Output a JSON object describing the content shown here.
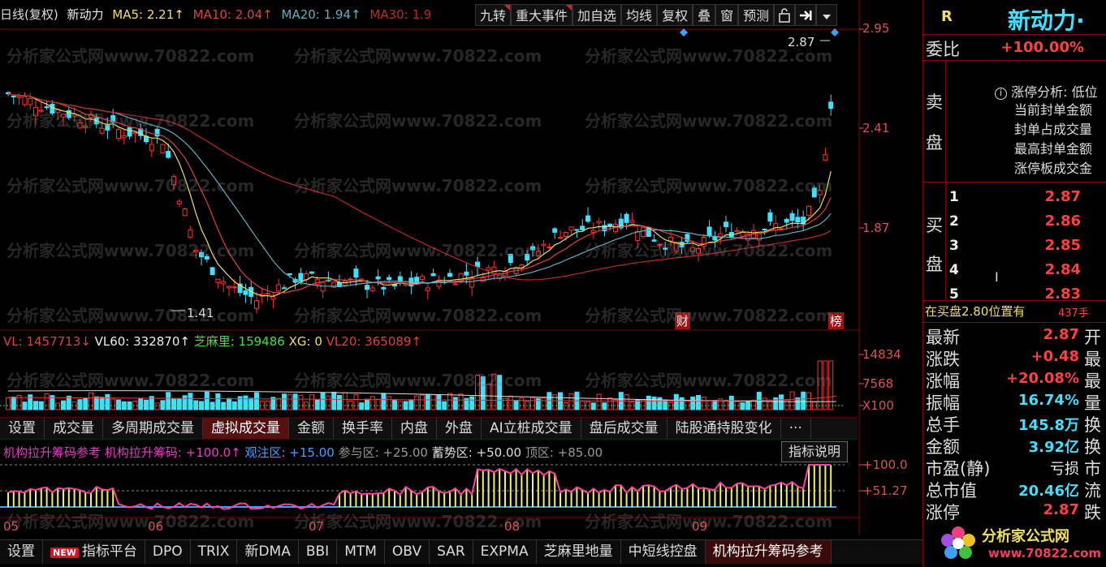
{
  "header": {
    "period": "日线(复权)",
    "stock_name": "新动力",
    "ma5": "MA5: 2.21↑",
    "ma10": "MA10: 2.04↑",
    "ma20": "MA20: 1.94↑",
    "ma30": "MA30: 1.9",
    "buttons": [
      "九转",
      "重大事件",
      "加自选",
      "均线",
      "复权",
      "叠",
      "窗",
      "预测"
    ],
    "icons": [
      "lock-icon",
      "pin-arrow-icon",
      "dropdown-icon"
    ]
  },
  "price_axis": {
    "labels": [
      "2.95",
      "2.41",
      "1.87"
    ]
  },
  "annotations": {
    "high": "2.87",
    "low": "1.41",
    "cai": "财",
    "bang": "榜"
  },
  "watermark": "分析家公式网www.70822.com",
  "volume": {
    "vl": "VL: 1457713↓",
    "vl60": "VL60: 332870↑",
    "zhimali": "芝麻里: 159486",
    "xg": "XG: 0",
    "vl20": "VL20: 365089↑",
    "axis": [
      "14834",
      "7568",
      "X100"
    ]
  },
  "tabs1": [
    "设置",
    "成交量",
    "多周期成交量",
    "虚拟成交量",
    "金额",
    "换手率",
    "内盘",
    "外盘",
    "AI立桩成交量",
    "盘后成交量",
    "陆股通持股变化",
    "···"
  ],
  "tabs1_active": "虚拟成交量",
  "indicator": {
    "name": "机构拉升筹码参考",
    "line1": "机构拉升筹码: +100.0↑",
    "line2": "观注区: +15.00",
    "line3": "参与区: +25.00",
    "line4": "蓄势区: +50.00",
    "line5": "顶区: +85.00",
    "button": "指标说明",
    "axis": [
      "+100.0",
      "+51.27"
    ]
  },
  "dates": [
    "05",
    "06",
    "07",
    "08",
    "09"
  ],
  "tabs2": [
    "设置",
    "指标平台",
    "DPO",
    "TRIX",
    "新DMA",
    "BBI",
    "MTM",
    "OBV",
    "SAR",
    "EXPMA",
    "芝麻里地量",
    "中短线控盘",
    "机构拉升筹码参考"
  ],
  "tabs2_new_badge": "NEW",
  "tabs2_active": "机构拉升筹码参考",
  "right_panel": {
    "r_label": "R",
    "title": "新动力",
    "title_suffix": "·",
    "weibi_label": "委比",
    "weibi_value": "+100.00%",
    "sell_label_1": "卖",
    "sell_label_2": "盘",
    "limit_analysis_title": "涨停分析: 低位",
    "limit_lines": [
      "当前封单金额",
      "封单占成交量",
      "最高封单金额",
      "涨停板成交金"
    ],
    "buy_label_1": "买",
    "buy_label_2": "盘",
    "buy_levels": [
      {
        "level": "1",
        "price": "2.87"
      },
      {
        "level": "2",
        "price": "2.86"
      },
      {
        "level": "3",
        "price": "2.85"
      },
      {
        "level": "4",
        "price": "2.84"
      },
      {
        "level": "5",
        "price": "2.83"
      }
    ],
    "position_note": "在买盘2.80位置有",
    "position_qty": "437手",
    "stats": [
      {
        "label": "最新",
        "value": "2.87",
        "extra": "开",
        "color": "red"
      },
      {
        "label": "涨跌",
        "value": "+0.48",
        "extra": "最",
        "color": "red"
      },
      {
        "label": "涨幅",
        "value": "+20.08%",
        "extra": "最",
        "color": "red"
      },
      {
        "label": "振幅",
        "value": "16.74%",
        "extra": "量",
        "color": "cyan"
      },
      {
        "label": "总手",
        "value": "145.8万",
        "extra": "换",
        "color": "cyan"
      },
      {
        "label": "金额",
        "value": "3.92亿",
        "extra": "换",
        "color": "cyan"
      },
      {
        "label": "市盈(静)",
        "value": "亏损",
        "extra": "市",
        "color": "white"
      },
      {
        "label": "总市值",
        "value": "20.46亿",
        "extra": "流",
        "color": "cyan"
      },
      {
        "label": "涨停",
        "value": "2.87",
        "extra": "跌",
        "color": "red"
      }
    ],
    "logo_text": "分析家公式网",
    "logo_url": "www.70822.com"
  }
}
